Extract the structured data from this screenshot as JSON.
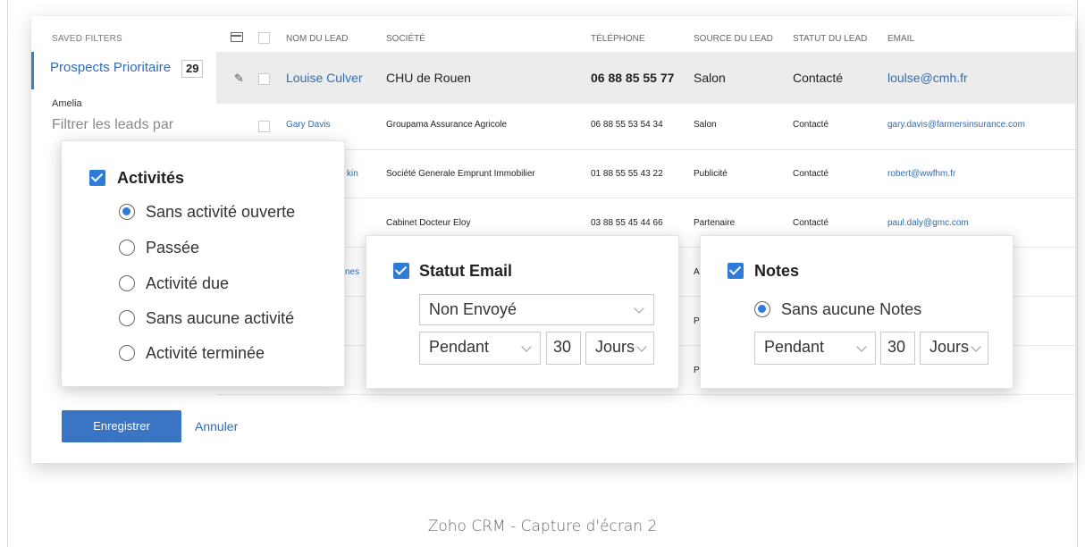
{
  "sidebar": {
    "title": "SAVED FILTERS",
    "active_filter": "Prospects Prioritaire",
    "active_count": "29",
    "user": "Amelia",
    "filter_placeholder": "Filtrer les leads par"
  },
  "table": {
    "columns": [
      "NOM DU LEAD",
      "SOCIÉTÉ",
      "TÉLÉPHONE",
      "SOURCE DU LEAD",
      "STATUT DU LEAD",
      "EMAIL"
    ],
    "rows": [
      {
        "name": "Louise Culver",
        "company": "CHU de Rouen",
        "phone": "06 88 85 55 77",
        "source": "Salon",
        "status": "Contacté",
        "email": "loulse@cmh.fr"
      },
      {
        "name": "Gary Davis",
        "company": "Groupama Assurance Agricole",
        "phone": "06 88 55 53 54 34",
        "source": "Salon",
        "status": "Contacté",
        "email": "gary.davis@farmersinsurance.com"
      },
      {
        "name": "kin",
        "company": "Société Generale Emprunt Immobilier",
        "phone": "01 88 55 55 43 22",
        "source": "Publicité",
        "status": "Contacté",
        "email": "robert@wwfhm.fr"
      },
      {
        "name": "",
        "company": "Cabinet Docteur Eloy",
        "phone": "03 88 55 45 44 66",
        "source": "Partenaire",
        "status": "Contacté",
        "email": "paul.daly@gmc.com"
      },
      {
        "name": "nes",
        "company": "",
        "phone": "",
        "source": "A",
        "status": "",
        "email": ""
      },
      {
        "name": "",
        "company": "",
        "phone": "",
        "source": "P",
        "status": "",
        "email": ""
      },
      {
        "name": "",
        "company": "",
        "phone": "",
        "source": "P",
        "status": "",
        "email": ""
      }
    ]
  },
  "activities_popup": {
    "title": "Activités",
    "options": [
      "Sans activité ouverte",
      "Passée",
      "Activité due",
      "Sans aucune activité",
      "Activité terminée"
    ],
    "selected": "Sans activité ouverte"
  },
  "email_popup": {
    "title": "Statut Email",
    "status_value": "Non Envoyé",
    "period_value": "Pendant",
    "number_value": "30",
    "unit_value": "Jours"
  },
  "notes_popup": {
    "title": "Notes",
    "option": "Sans aucune Notes",
    "period_value": "Pendant",
    "number_value": "30",
    "unit_value": "Jours"
  },
  "actions": {
    "save_label": "Enregistrer",
    "cancel_label": "Annuler"
  },
  "caption": "Zoho CRM - Capture d'écran 2",
  "colors": {
    "accent": "#2f7bd8",
    "link": "#2f6db5",
    "button": "#3a75c4",
    "highlight_row": "#ececec"
  }
}
